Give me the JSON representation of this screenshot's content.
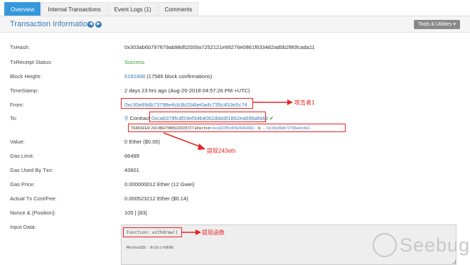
{
  "tabs": [
    {
      "label": "Overview",
      "active": true
    },
    {
      "label": "Internal Transactions",
      "active": false
    },
    {
      "label": "Event Logs (1)",
      "active": false
    },
    {
      "label": "Comments",
      "active": false
    }
  ],
  "header": {
    "title": "Transaction Information",
    "tools_label": "Tools & Utilities"
  },
  "rows": {
    "txhash": {
      "label": "TxHash:",
      "value": "0x303ab6b797679ab98d52009a7252121e99276e0861f633482ad0b2f80fcada11"
    },
    "status": {
      "label": "TxReceipt Status:",
      "value": "Success"
    },
    "block": {
      "label": "Block Height:",
      "value_link": "6182468",
      "value_rest": " (17586 block confirmations)"
    },
    "timestamp": {
      "label": "TimeStamp:",
      "value": "2 days 23 hrs ago (Aug-20-2018 04:57:26 PM +UTC)"
    },
    "from": {
      "label": "From:",
      "value": "0xc30e89db73798e4cb3b204be0a4c735c453e5c74"
    },
    "to": {
      "label": "To:",
      "prefix": "Contract",
      "value": "0xca6378fcdf24ef34b4062dda9f1862ea59bafd4d"
    },
    "value": {
      "label": "Value:",
      "value": "0 Ether ($0.00)"
    },
    "gas_limit": {
      "label": "Gas Limit:",
      "value": "66499"
    },
    "gas_used": {
      "label": "Gas Used By Txn:",
      "value": "43601"
    },
    "gas_price": {
      "label": "Gas Price:",
      "value": "0.000000012 Ether (12 Gwei)"
    },
    "cost": {
      "label": "Actual Tx Cost/Fee:",
      "value": "0.000523212 Ether ($0.14)"
    },
    "nonce": {
      "label": "Nonce & {Position}:",
      "value": "105 | {83}"
    },
    "input": {
      "label": "Input Data:"
    }
  },
  "transfer": {
    "prefix": "TRANSFER",
    "amount": " 243.886278895220035727 Ether from ",
    "from": "0xca6378fcdf24ef34b4062...",
    "to_label": " to → ",
    "to": "0xc30e89db73798e4cb3b2..."
  },
  "input_data": {
    "function": "Function: withdraw()",
    "method_id": "MethodID: 0x3ccfd60b"
  },
  "annotations": {
    "attacker": "攻击者1",
    "withdraw_eth": "提现243eth",
    "withdraw_func": "提现函数"
  },
  "watermark": "Seebug",
  "colors": {
    "accent": "#3498db",
    "link": "#3a7bb8",
    "success": "#2e9e2e",
    "annotation": "#e52323"
  }
}
